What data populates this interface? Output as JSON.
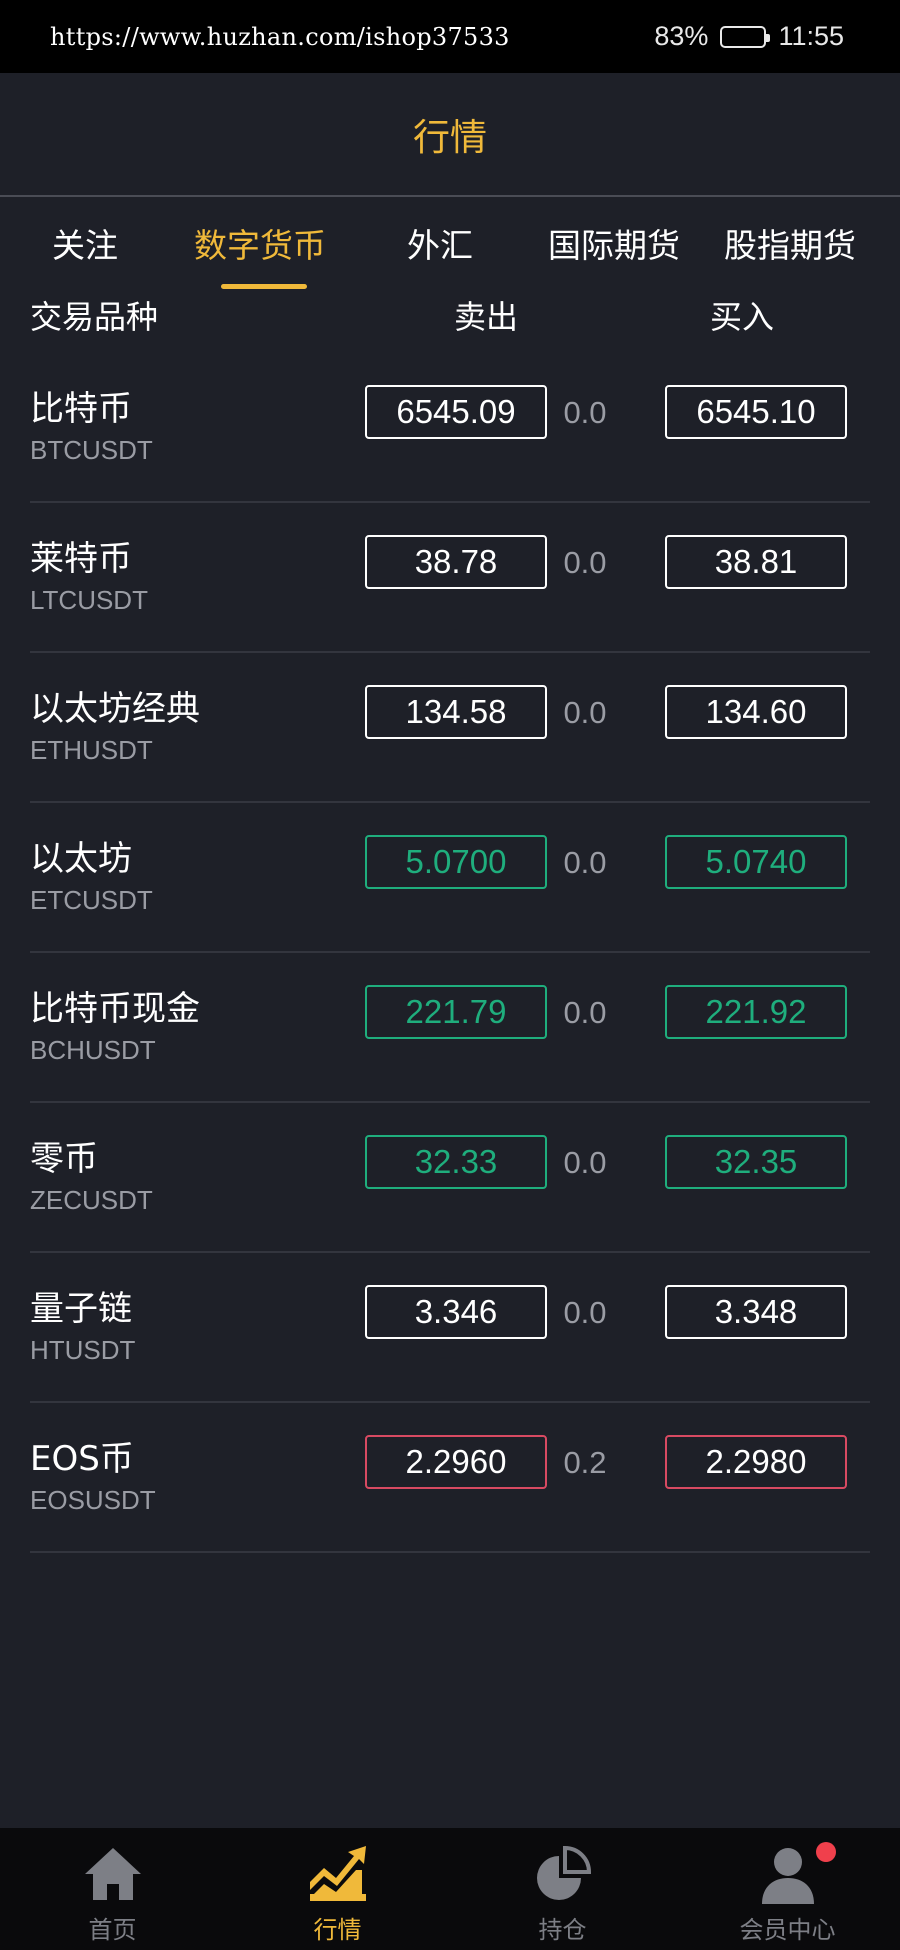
{
  "status_bar": {
    "url": "https://www.huzhan.com/ishop37533",
    "battery": "83%",
    "time": "11:55"
  },
  "header": {
    "title": "行情"
  },
  "tabs": [
    {
      "label": "关注",
      "active": false
    },
    {
      "label": "数字货币",
      "active": true
    },
    {
      "label": "外汇",
      "active": false
    },
    {
      "label": "国际期货",
      "active": false
    },
    {
      "label": "股指期货",
      "active": false
    }
  ],
  "columns": {
    "instrument": "交易品种",
    "sell": "卖出",
    "buy": "买入"
  },
  "rows": [
    {
      "name": "比特币",
      "code": "BTCUSDT",
      "sell": "6545.09",
      "spread": "0.0",
      "buy": "6545.10",
      "trend": "neutral"
    },
    {
      "name": "莱特币",
      "code": "LTCUSDT",
      "sell": "38.78",
      "spread": "0.0",
      "buy": "38.81",
      "trend": "neutral"
    },
    {
      "name": "以太坊经典",
      "code": "ETHUSDT",
      "sell": "134.58",
      "spread": "0.0",
      "buy": "134.60",
      "trend": "neutral"
    },
    {
      "name": "以太坊",
      "code": "ETCUSDT",
      "sell": "5.0700",
      "spread": "0.0",
      "buy": "5.0740",
      "trend": "up"
    },
    {
      "name": "比特币现金",
      "code": "BCHUSDT",
      "sell": "221.79",
      "spread": "0.0",
      "buy": "221.92",
      "trend": "up"
    },
    {
      "name": "零币",
      "code": "ZECUSDT",
      "sell": "32.33",
      "spread": "0.0",
      "buy": "32.35",
      "trend": "up"
    },
    {
      "name": "量子链",
      "code": "HTUSDT",
      "sell": "3.346",
      "spread": "0.0",
      "buy": "3.348",
      "trend": "neutral"
    },
    {
      "name": "EOS币",
      "code": "EOSUSDT",
      "sell": "2.2960",
      "spread": "0.2",
      "buy": "2.2980",
      "trend": "down"
    }
  ],
  "bottom_nav": [
    {
      "label": "首页",
      "icon": "home-icon",
      "active": false
    },
    {
      "label": "行情",
      "icon": "market-chart-icon",
      "active": true
    },
    {
      "label": "持仓",
      "icon": "pie-chart-icon",
      "active": false
    },
    {
      "label": "会员中心",
      "icon": "user-icon",
      "active": false,
      "badge": true
    }
  ],
  "colors": {
    "accent": "#f0b93a",
    "up": "#1fae7d",
    "down": "#d84a62",
    "background": "#1e2028"
  }
}
